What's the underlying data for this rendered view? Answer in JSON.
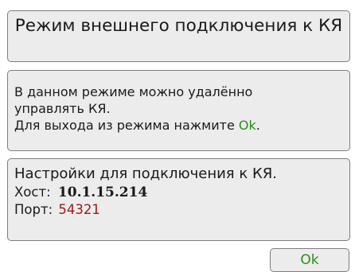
{
  "title": "Режим внешнего подключения к КЯ",
  "message": {
    "line1": "В данном режиме можно удалённо",
    "line2": "управлять КЯ.",
    "line3_prefix": "Для выхода из режима нажмите ",
    "line3_ok": "Ok",
    "line3_suffix": "."
  },
  "settings": {
    "title": "Настройки для подключения к КЯ.",
    "host_label": "Хост:",
    "host_value": "10.1.15.214",
    "port_label": "Порт:",
    "port_value": "54321"
  },
  "ok_button": {
    "label": "Ok"
  },
  "colors": {
    "ok_text": "#2e8b1e",
    "port_value": "#a01818",
    "ok_button_text": "#2e8b1e"
  }
}
